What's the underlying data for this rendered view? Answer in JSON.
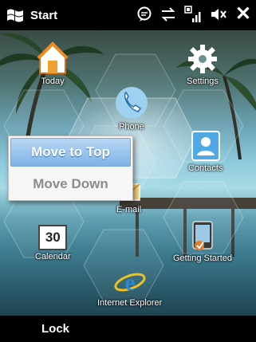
{
  "topbar": {
    "start_label": "Start",
    "icons": [
      "windows-flag-icon",
      "chat-icon",
      "data-sync-icon",
      "signal-strength-icon",
      "speaker-mute-icon",
      "close-icon"
    ],
    "close_glyph": "✕"
  },
  "tiles": {
    "today": "Today",
    "settings": "Settings",
    "phone": "Phone",
    "contacts": "Contacts",
    "email": "E-mail",
    "calendar": "Calendar",
    "calendar_day": "30",
    "getting_started": "Getting Started",
    "internet_explorer": "Internet Explorer"
  },
  "context_menu": {
    "move_to_top": "Move to Top",
    "move_down": "Move Down"
  },
  "bottombar": {
    "lock_label": "Lock"
  }
}
